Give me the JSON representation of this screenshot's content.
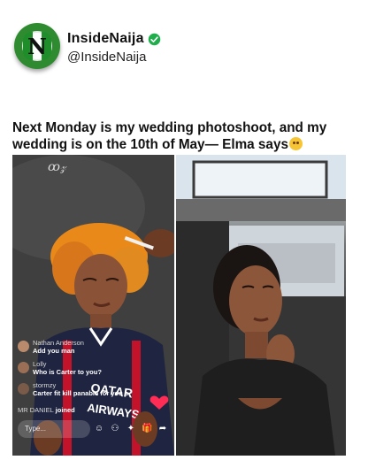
{
  "account": {
    "name": "InsideNaija",
    "handle": "@InsideNaija",
    "avatar_letter": "N",
    "verified_color": "#1da1f2",
    "brand_color": "#2f8b2f"
  },
  "headline": "Next Monday is my wedding photoshoot, and my wedding is on the 10th of May— Elma says",
  "headline_emoji": "star-struck-emoji",
  "left_image": {
    "live_comments": [
      {
        "user": "Nathan Anderson",
        "message": "Add you man"
      },
      {
        "user": "Lolly",
        "message": "Who is Carter to you?"
      },
      {
        "user": "stormzy",
        "message": "Carter fit kill panable for you o"
      },
      {
        "user": "MR DANIEL",
        "message": "joined"
      }
    ],
    "input_placeholder": "Type...",
    "shirt_text": "QATAR AIRWAYS"
  }
}
